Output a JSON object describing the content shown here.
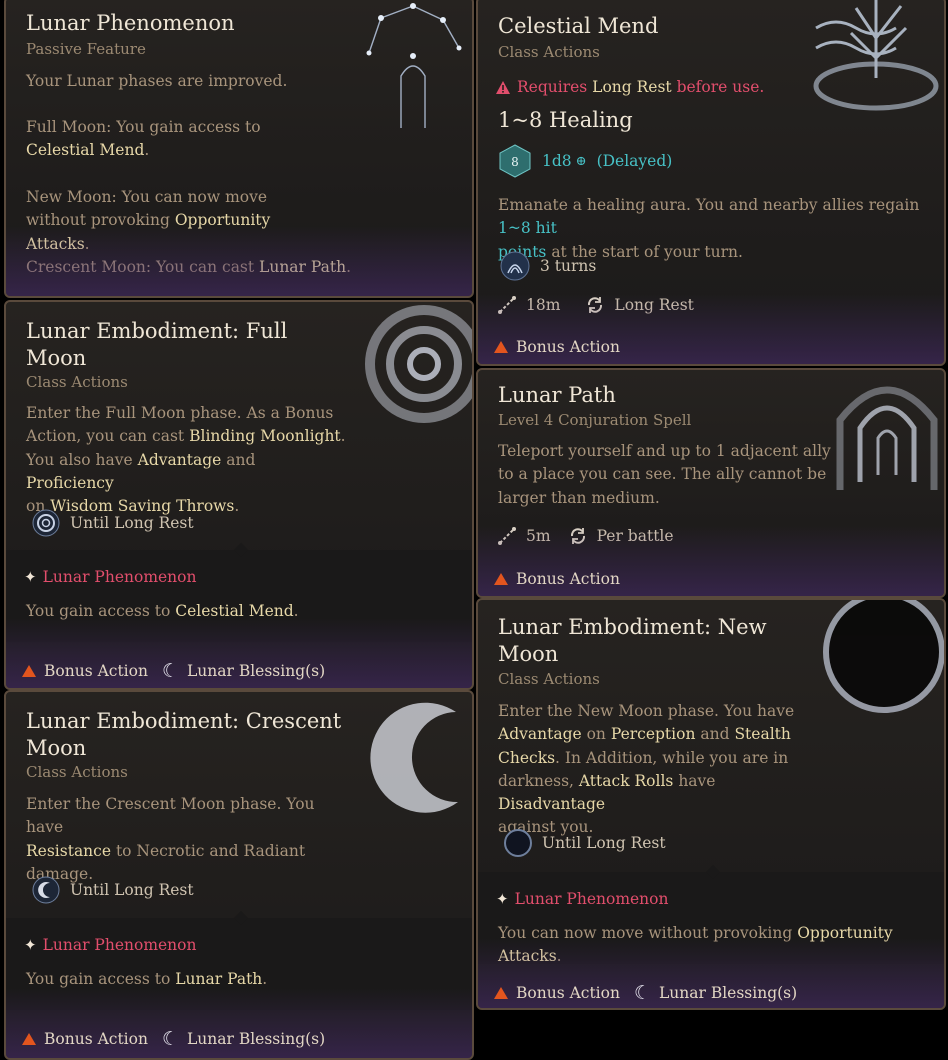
{
  "cards": {
    "lunar_phenomenon": {
      "title": "Lunar Phenomenon",
      "subtitle": "Passive Feature",
      "intro": "Your Lunar phases are improved.",
      "full_moon_pre": "Full Moon: You gain access to ",
      "full_moon_link": "Celestial Mend",
      "full_moon_post": ".",
      "new_moon_pre": "New Moon: You can now move without provoking ",
      "new_moon_link": "Opportunity Attacks",
      "new_moon_post": ".",
      "crescent_pre": "Crescent Moon: You can cast ",
      "crescent_link": "Lunar Path",
      "crescent_post": "."
    },
    "full_moon": {
      "title_line1": "Lunar Embodiment: Full",
      "title_line2": "Moon",
      "subtitle": "Class Actions",
      "d1": "Enter the Full Moon phase. As a Bonus",
      "d2a": "Action, you can cast ",
      "d2b": "Blinding Moonlight",
      "d2c": ".",
      "d3a": "You also have ",
      "d3b": "Advantage",
      "d3c": " and ",
      "d3d": "Proficiency",
      "d4a": "on ",
      "d4b": "Wisdom Saving Throws",
      "d4c": ".",
      "duration": "Until Long Rest",
      "passive_name": "Lunar Phenomenon",
      "passive_pre": "You gain access to ",
      "passive_link": "Celestial Mend",
      "passive_post": ".",
      "cost1": "Bonus Action",
      "cost2": "Lunar Blessing(s)"
    },
    "crescent": {
      "title_line1": "Lunar Embodiment: Crescent",
      "title_line2": "Moon",
      "subtitle": "Class Actions",
      "d1": "Enter the Crescent Moon phase. You have",
      "d2a": "Resistance",
      "d2b": " to Necrotic and Radiant",
      "d3": "damage.",
      "duration": "Until Long Rest",
      "passive_name": "Lunar Phenomenon",
      "passive_pre": "You gain access to ",
      "passive_link": "Lunar Path",
      "passive_post": ".",
      "cost1": "Bonus Action",
      "cost2": "Lunar Blessing(s)"
    },
    "celestial_mend": {
      "title": "Celestial Mend",
      "subtitle": "Class Actions",
      "req_a": "Requires ",
      "req_b": "Long Rest",
      "req_c": " before use.",
      "healing": "1~8 Healing",
      "die_label": "8",
      "dice": "1d8",
      "delayed": "(Delayed)",
      "d1a": "Emanate a healing aura. You and nearby allies regain ",
      "d1b": "1~8 hit",
      "d2a": "points",
      "d2b": " at the start of your turn.",
      "turns": "3 turns",
      "range": "18m",
      "recharge": "Long Rest",
      "cost": "Bonus Action"
    },
    "lunar_path": {
      "title": "Lunar Path",
      "subtitle": "Level 4 Conjuration Spell",
      "d1": "Teleport yourself and up to 1 adjacent ally",
      "d2": "to a place you can see. The ally cannot be",
      "d3": "larger than medium.",
      "range": "5m",
      "recharge": "Per battle",
      "cost": "Bonus Action"
    },
    "new_moon": {
      "title_line1": "Lunar Embodiment: New",
      "title_line2": "Moon",
      "subtitle": "Class Actions",
      "d1": "Enter the New Moon phase. You have",
      "d2a": "Advantage",
      "d2b": " on ",
      "d2c": "Perception",
      "d2d": " and ",
      "d2e": "Stealth",
      "d3a": "Checks",
      "d3b": ". In Addition, while you are in",
      "d4a": "darkness, ",
      "d4b": "Attack Rolls",
      "d4c": " have ",
      "d4d": "Disadvantage",
      "d5": "against you.",
      "duration": "Until Long Rest",
      "passive_name": "Lunar Phenomenon",
      "passive_pre": "You can now move without provoking ",
      "passive_link": "Opportunity Attacks",
      "passive_post": ".",
      "cost1": "Bonus Action",
      "cost2": "Lunar Blessing(s)"
    }
  },
  "colors": {
    "highlight": "#e7d8a8",
    "teal": "#47c1c6",
    "warning": "#e24e6c",
    "action_triangle": "#e2551e",
    "border": "#5a4a3c"
  },
  "icons": [
    "constellation-icon",
    "spiral-moon-icon",
    "crescent-moon-icon",
    "sun-tree-icon",
    "portal-arch-icon",
    "dark-moon-icon",
    "die-icon",
    "range-icon",
    "recharge-icon",
    "sparkle-icon",
    "bonus-action-triangle-icon",
    "moon-icon"
  ]
}
